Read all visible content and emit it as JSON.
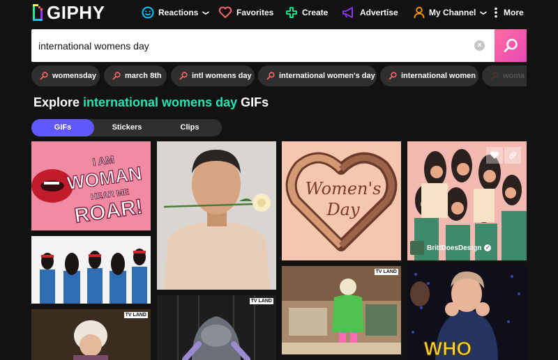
{
  "header": {
    "logo_text": "GIPHY",
    "nav": [
      {
        "label": "Reactions",
        "has_chevron": true,
        "icon": "smiley-icon"
      },
      {
        "label": "Favorites",
        "has_chevron": false,
        "icon": "heart-icon"
      },
      {
        "label": "Create",
        "has_chevron": false,
        "icon": "plus-icon"
      },
      {
        "label": "Advertise",
        "has_chevron": false,
        "icon": "megaphone-icon"
      },
      {
        "label": "My Channel",
        "has_chevron": true,
        "icon": "user-icon"
      },
      {
        "label": "More",
        "has_chevron": false,
        "icon": "kebab-icon"
      }
    ],
    "chevron": "❯"
  },
  "search": {
    "value": "international womens day",
    "clear_glyph": "×"
  },
  "suggestions": [
    "womensday",
    "march 8th",
    "intl womens day",
    "international women's day",
    "international women",
    "woma"
  ],
  "explore": {
    "prefix": "Explore",
    "query": "international womens day",
    "suffix": "GIFs"
  },
  "tabs": [
    "GIFs",
    "Stickers",
    "Clips"
  ],
  "gifs": {
    "roar": {
      "lines": [
        "I AM",
        "WOMAN",
        "HEAR ME",
        "ROAR!"
      ]
    },
    "womens_day": {
      "lines": [
        "Women's",
        "Day"
      ]
    },
    "britt": {
      "username": "BrittDoesDesign",
      "verified_glyph": "✓"
    },
    "who": {
      "caption": "WHO"
    },
    "tvland_badge": "TV LAND"
  },
  "colors": {
    "background": "#121212",
    "accent_teal": "#24e6b4",
    "tab_active": "#6157ff",
    "search_button": "#e646b6",
    "pill": "#2f2f2f"
  }
}
